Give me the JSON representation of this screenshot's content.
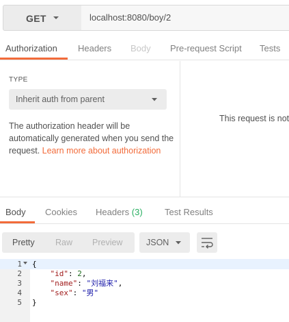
{
  "request": {
    "method": "GET",
    "url": "localhost:8080/boy/2"
  },
  "request_tabs": [
    {
      "label": "Authorization",
      "state": "active"
    },
    {
      "label": "Headers",
      "state": "normal"
    },
    {
      "label": "Body",
      "state": "disabled"
    },
    {
      "label": "Pre-request Script",
      "state": "normal"
    },
    {
      "label": "Tests",
      "state": "normal"
    }
  ],
  "auth": {
    "type_label": "TYPE",
    "type_value": "Inherit auth from parent",
    "description": "The authorization header will be automatically generated when you send the request.",
    "learn_more": "Learn more about authorization",
    "right_message": "This request is not"
  },
  "response_tabs": [
    {
      "label": "Body",
      "state": "active"
    },
    {
      "label": "Cookies",
      "state": "normal"
    },
    {
      "label": "Headers",
      "count": "(3)",
      "state": "normal"
    },
    {
      "label": "Test Results",
      "state": "normal"
    }
  ],
  "toolbar": {
    "views": [
      {
        "label": "Pretty",
        "state": "active"
      },
      {
        "label": "Raw",
        "state": "normal"
      },
      {
        "label": "Preview",
        "state": "normal"
      }
    ],
    "format": "JSON",
    "wrap_icon": "wrap-lines-icon"
  },
  "code": {
    "lines": [
      "1",
      "2",
      "3",
      "4",
      "5"
    ],
    "open_brace": "{",
    "close_brace": "}",
    "id_key": "\"id\"",
    "id_value": "2",
    "name_key": "\"name\"",
    "name_value": "\"刘福来\"",
    "sex_key": "\"sex\"",
    "sex_value": "\"男\""
  },
  "colors": {
    "accent": "#f26b3a",
    "count_green": "#27ae60"
  }
}
